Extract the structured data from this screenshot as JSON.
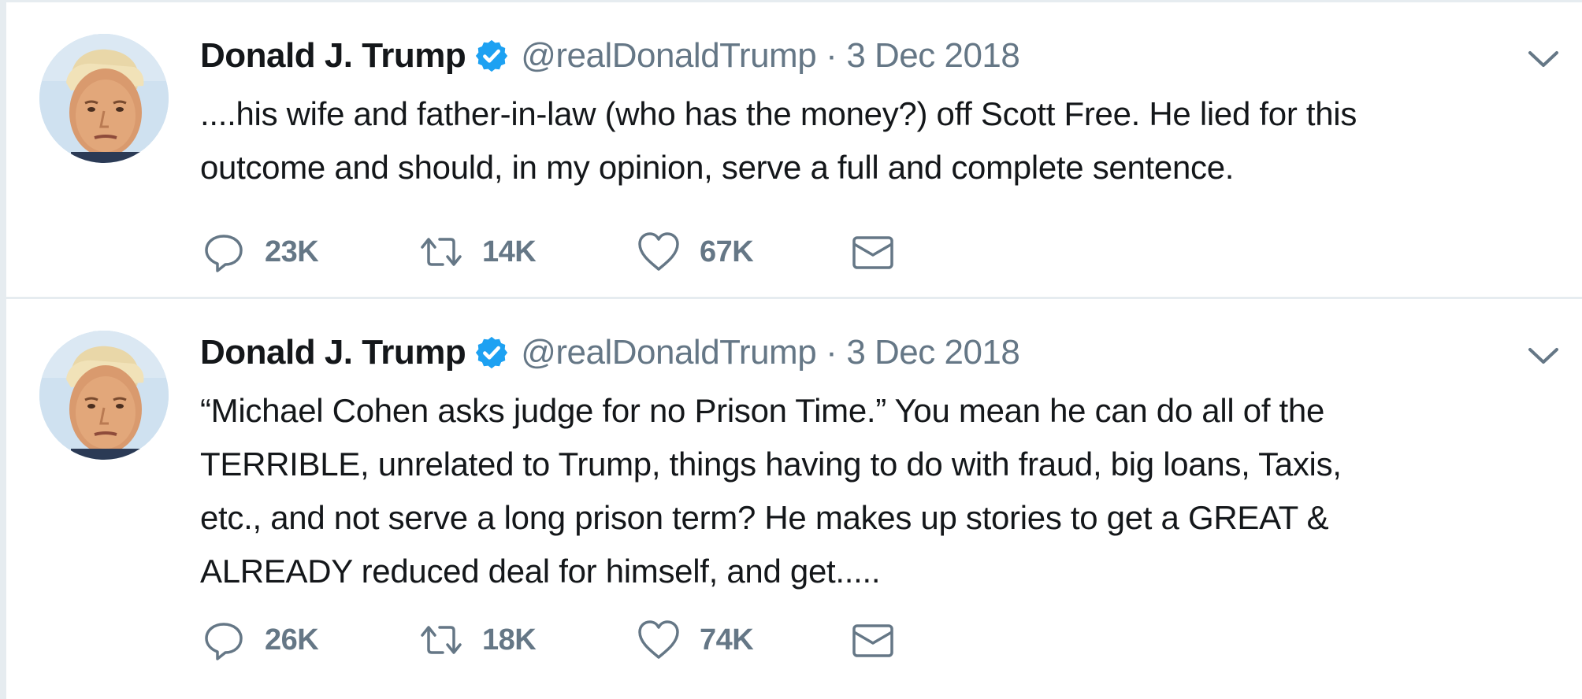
{
  "colors": {
    "accent": "#1da1f2",
    "text_primary": "#14171a",
    "text_secondary": "#657786",
    "divider": "#e6ecf0"
  },
  "tweets": [
    {
      "author": {
        "name": "Donald J. Trump",
        "handle": "@realDonaldTrump",
        "verified": true
      },
      "separator": "·",
      "date": "3 Dec 2018",
      "lines": [
        "....his wife and father-in-law (who has the money?) off Scott Free. He lied for this",
        "outcome and should, in my opinion, serve a full and complete sentence."
      ],
      "stats": {
        "replies": "23K",
        "retweets": "14K",
        "likes": "67K"
      }
    },
    {
      "author": {
        "name": "Donald J. Trump",
        "handle": "@realDonaldTrump",
        "verified": true
      },
      "separator": "·",
      "date": "3 Dec 2018",
      "lines": [
        "“Michael Cohen asks judge for no Prison Time.” You mean he can do all of the",
        "TERRIBLE, unrelated to Trump, things having to do with fraud, big loans, Taxis,",
        "etc., and not serve a long prison term? He makes up stories to get a GREAT &",
        "ALREADY reduced deal for himself, and get....."
      ],
      "stats": {
        "replies": "26K",
        "retweets": "18K",
        "likes": "74K"
      }
    }
  ],
  "icons": {
    "reply": "reply-icon",
    "retweet": "retweet-icon",
    "like": "heart-icon",
    "dm": "envelope-icon",
    "verified": "verified-badge-icon",
    "more": "chevron-down-icon"
  }
}
